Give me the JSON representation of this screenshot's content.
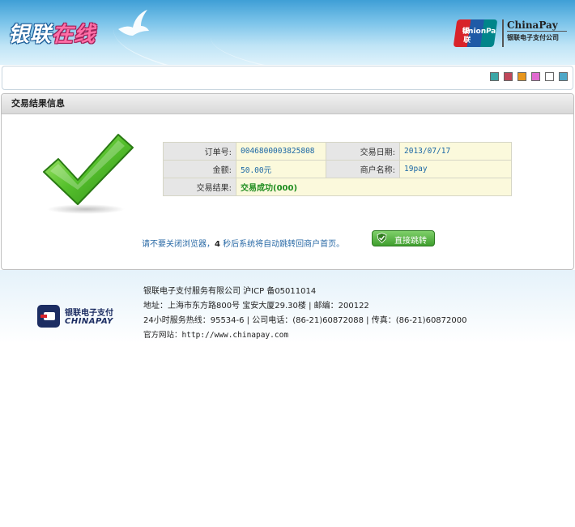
{
  "header": {
    "logo_part1": "银联",
    "logo_part2": "在线",
    "unionpay_en": "UnionPay",
    "unionpay_cn": "银联",
    "chinapay_en": "ChinaPay",
    "chinapay_cn": "银联电子支付公司"
  },
  "toolbar": {
    "swatches": [
      "#3aa6a6",
      "#c0475a",
      "#e8961c",
      "#e06ad0",
      "#ffffff",
      "#4fa8c8"
    ]
  },
  "panel": {
    "title": "交易结果信息",
    "rows": [
      {
        "label1": "订单号:",
        "value1": "0046800003825808",
        "label2": "交易日期:",
        "value2": "2013/07/17"
      },
      {
        "label1": "金额:",
        "value1": "50.00元",
        "label2": "商户名称:",
        "value2": "19pay"
      }
    ],
    "result_label": "交易结果:",
    "result_value": "交易成功(000)",
    "redirect_before": "请不要关闭浏览器，",
    "redirect_count": "4",
    "redirect_after": "  秒后系统将自动跳转回商户首页。",
    "jump_button": "直接跳转"
  },
  "footer": {
    "logo_cn": "银联电子支付",
    "logo_en": "CHINAPAY",
    "line1": "银联电子支付服务有限公司 沪ICP 备05011014",
    "line2": "地址：上海市东方路800号 宝安大厦29.30楼 | 邮编：200122",
    "line3": "24小时服务热线：95534-6 | 公司电话：(86-21)60872088 | 传真：(86-21)60872000",
    "line4": "官方网站：http://www.chinapay.com"
  },
  "colors": {
    "success_green": "#1f8d1f",
    "link_blue": "#2a6aa6",
    "brand_navy": "#1c2d62"
  }
}
